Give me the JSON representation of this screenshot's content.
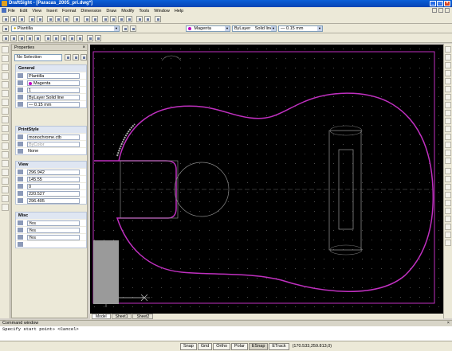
{
  "window": {
    "title": "DraftSight - [Paracas_2005_pri.dwg*]"
  },
  "menu": [
    "File",
    "Edit",
    "View",
    "Insert",
    "Format",
    "Dimension",
    "Draw",
    "Modify",
    "Tools",
    "Window",
    "Help"
  ],
  "toolbar": {
    "layer": "Plantilla",
    "color": "Magenta",
    "linestyle_left": "ByLayer",
    "linestyle_right": "Solid line",
    "lineweight": "0.15 mm"
  },
  "properties": {
    "title": "Properties",
    "selection": "No Selection",
    "general": {
      "title": "General",
      "layer": "Plantilla",
      "color": "Magenta",
      "scale": "1",
      "linestyle_left": "ByLayer",
      "linestyle_right": "Solid line",
      "lineweight": "0.15 mm"
    },
    "printstyle": {
      "title": "PrintStyle",
      "table": "monochrome.ctb",
      "style": "ByColor",
      "plot": "None"
    },
    "view": {
      "title": "View",
      "values": [
        "296.942",
        "145.55",
        "0",
        "220.527",
        "296.405"
      ]
    },
    "misc": {
      "title": "Misc",
      "values": [
        "Yes",
        "Yes",
        "Yes"
      ]
    }
  },
  "tabs": [
    "Model",
    "Sheet1",
    "Sheet2"
  ],
  "command": {
    "title": "Command window",
    "prompt": "Specify start point» <Cancel>"
  },
  "status": {
    "buttons": [
      "Snap",
      "Grid",
      "Ortho",
      "Polar",
      "ESnap",
      "ETrack"
    ],
    "coords": "(170.533,259.813,0)"
  },
  "colors": {
    "accent_magenta": "#c030c0",
    "canvas_bg": "#000000"
  }
}
